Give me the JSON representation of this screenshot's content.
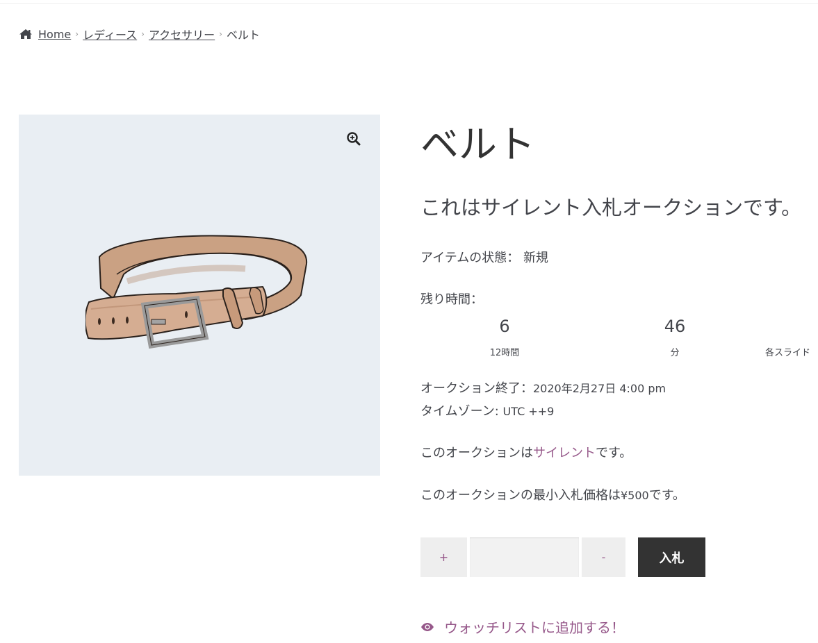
{
  "breadcrumb": {
    "items": [
      {
        "label": "Home"
      },
      {
        "label": "レディース"
      },
      {
        "label": "アクセサリー"
      }
    ],
    "current": "ベルト"
  },
  "product": {
    "title": "ベルト",
    "notice": "これはサイレント入札オークションです。",
    "condition_label": "アイテムの状態：",
    "condition_value": "新規",
    "time_left_label": "残り時間：",
    "countdown": [
      {
        "value": "6",
        "label": "12時間"
      },
      {
        "value": "46",
        "label": "分"
      },
      {
        "value": "",
        "label": "各スライド"
      }
    ],
    "end_label": "オークション終了：",
    "end_value": "2020年2月27日 4:00 pm",
    "timezone_label": "タイムゾーン:",
    "timezone_value": "UTC ++9",
    "silent_prefix": "このオークションは",
    "silent_link": "サイレント",
    "silent_suffix": "です。",
    "min_bid_prefix": "このオークションの最小入札価格は",
    "min_bid_value": "¥500",
    "min_bid_suffix": "です。"
  },
  "bid_form": {
    "plus_label": "+",
    "minus_label": "-",
    "input_value": "",
    "submit_label": "入札"
  },
  "watchlist": {
    "label": "ウォッチリストに追加する！"
  },
  "icons": {
    "home": "home-icon",
    "zoom": "zoom-in-icon",
    "eye": "eye-icon"
  },
  "colors": {
    "accent": "#96588a",
    "button_dark": "#333333",
    "gallery_bg": "#e9eef3"
  }
}
